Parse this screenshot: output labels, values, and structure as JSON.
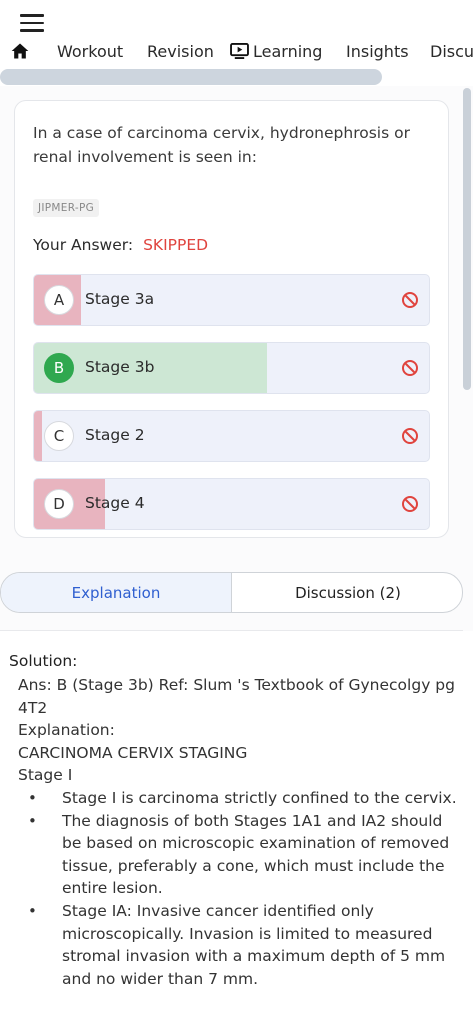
{
  "nav": {
    "tabs": [
      "Workout",
      "Revision",
      "Learning",
      "Insights",
      "Discu"
    ]
  },
  "question": {
    "text": "In a case of carcinoma cervix, hydronephrosis or renal involvement is seen in:",
    "source_tag": "JIPMER-PG",
    "your_answer_label": "Your Answer:",
    "your_answer_value": "SKIPPED",
    "options": [
      {
        "letter": "A",
        "text": "Stage 3a",
        "response_fraction": 0.12,
        "correct": false
      },
      {
        "letter": "B",
        "text": "Stage 3b",
        "response_fraction": 0.59,
        "correct": true
      },
      {
        "letter": "C",
        "text": "Stage 2",
        "response_fraction": 0.02,
        "correct": false
      },
      {
        "letter": "D",
        "text": "Stage 4",
        "response_fraction": 0.18,
        "correct": false
      }
    ]
  },
  "segments": {
    "explanation": "Explanation",
    "discussion": "Discussion (2)"
  },
  "solution": {
    "title": "Solution:",
    "answer_line": "Ans: B (Stage 3b) Ref: Slum 's Textbook of Gynecolgy pg 4T2",
    "explanation_label": "Explanation:",
    "heading": "CARCINOMA CERVIX STAGING",
    "subheading": "Stage I",
    "bullets": [
      "Stage I is carcinoma strictly confined to the cervix.",
      "The diagnosis of both Stages 1A1 and IA2 should be based on microscopic examination of removed tissue, preferably a cone, which must include the entire lesion.",
      "Stage IA: Invasive cancer identified only microscopically. Invasion is limited to measured stromal invasion with a maximum depth of 5 mm and no wider than 7 mm."
    ]
  },
  "colors": {
    "wrong_fill": "#e8b4bf",
    "correct_fill": "#cde7d4",
    "skipped": "#e0443e",
    "accent": "#2f5fd0"
  }
}
